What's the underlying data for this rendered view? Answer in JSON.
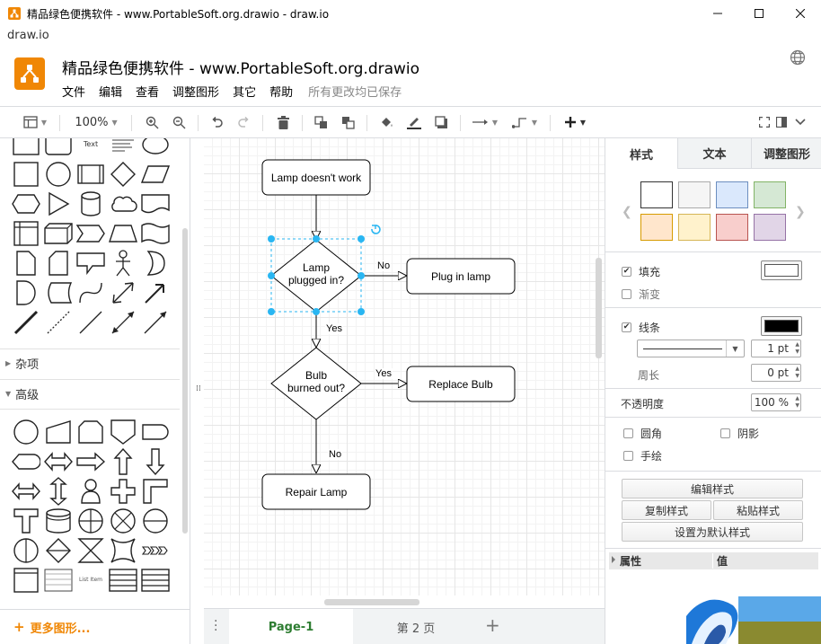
{
  "window": {
    "title": "精品绿色便携软件 - www.PortableSoft.org.drawio - draw.io",
    "minimize_icon": "minimize-icon",
    "maximize_icon": "maximize-icon",
    "close_icon": "close-icon"
  },
  "urlbar": {
    "text": "draw.io"
  },
  "header": {
    "doc_title": "精品绿色便携软件 - www.PortableSoft.org.drawio",
    "menu": [
      "文件",
      "编辑",
      "查看",
      "调整图形",
      "其它",
      "帮助"
    ],
    "save_status": "所有更改均已保存"
  },
  "toolbar": {
    "zoom": "100%",
    "icons": [
      "view-panels-icon",
      "zoom-in-icon",
      "zoom-out-icon",
      "undo-icon",
      "redo-icon",
      "delete-icon",
      "to-front-icon",
      "to-back-icon",
      "fill-color-icon",
      "line-color-icon",
      "shadow-icon",
      "connection-icon",
      "waypoints-icon",
      "insert-icon",
      "fullscreen-icon",
      "format-panel-icon",
      "collapse-icon"
    ]
  },
  "left_panel": {
    "text_shape_label": "Text",
    "sections": [
      "杂项",
      "高级"
    ],
    "list_item_label": "List Item",
    "more_shapes": "更多图形..."
  },
  "diagram": {
    "nodes": {
      "lamp_not_work": "Lamp doesn't work",
      "plugged_line1": "Lamp",
      "plugged_line2": "plugged in?",
      "plug_in": "Plug in lamp",
      "bulb_line1": "Bulb",
      "bulb_line2": "burned out?",
      "replace": "Replace Bulb",
      "repair": "Repair Lamp"
    },
    "edges": {
      "no1": "No",
      "yes1": "Yes",
      "yes2": "Yes",
      "no2": "No"
    }
  },
  "pages": {
    "active": "Page-1",
    "inactive": "第 2 页",
    "add": "+"
  },
  "right_panel": {
    "tabs": [
      "样式",
      "文本",
      "调整图形"
    ],
    "swatches": [
      {
        "fill": "#ffffff",
        "border": "#333333"
      },
      {
        "fill": "#f5f5f5",
        "border": "#aaaaaa"
      },
      {
        "fill": "#dae8fc",
        "border": "#6c8ebf"
      },
      {
        "fill": "#d5e8d4",
        "border": "#82b366"
      },
      {
        "fill": "#ffe6cc",
        "border": "#d79b00"
      },
      {
        "fill": "#fff2cc",
        "border": "#d6b656"
      },
      {
        "fill": "#f8cecc",
        "border": "#b85450"
      },
      {
        "fill": "#e1d5e7",
        "border": "#9673a6"
      }
    ],
    "fill_label": "填充",
    "gradient_label": "渐变",
    "line_label": "线条",
    "line_width": "1 pt",
    "perimeter_label": "周长",
    "perimeter_value": "0 pt",
    "opacity_label": "不透明度",
    "opacity_value": "100 %",
    "rounded_label": "圆角",
    "shadow_label": "阴影",
    "sketch_label": "手绘",
    "edit_style": "编辑样式",
    "copy_style": "复制样式",
    "paste_style": "粘贴样式",
    "set_default": "设置为默认样式",
    "props_col1": "属性",
    "props_col2": "值",
    "fill_color": "#ffffff",
    "line_color": "#000000"
  },
  "colors": {
    "accent": "#f08705",
    "selection": "#29b6f2",
    "page_tab_active": "#2e7d32"
  }
}
